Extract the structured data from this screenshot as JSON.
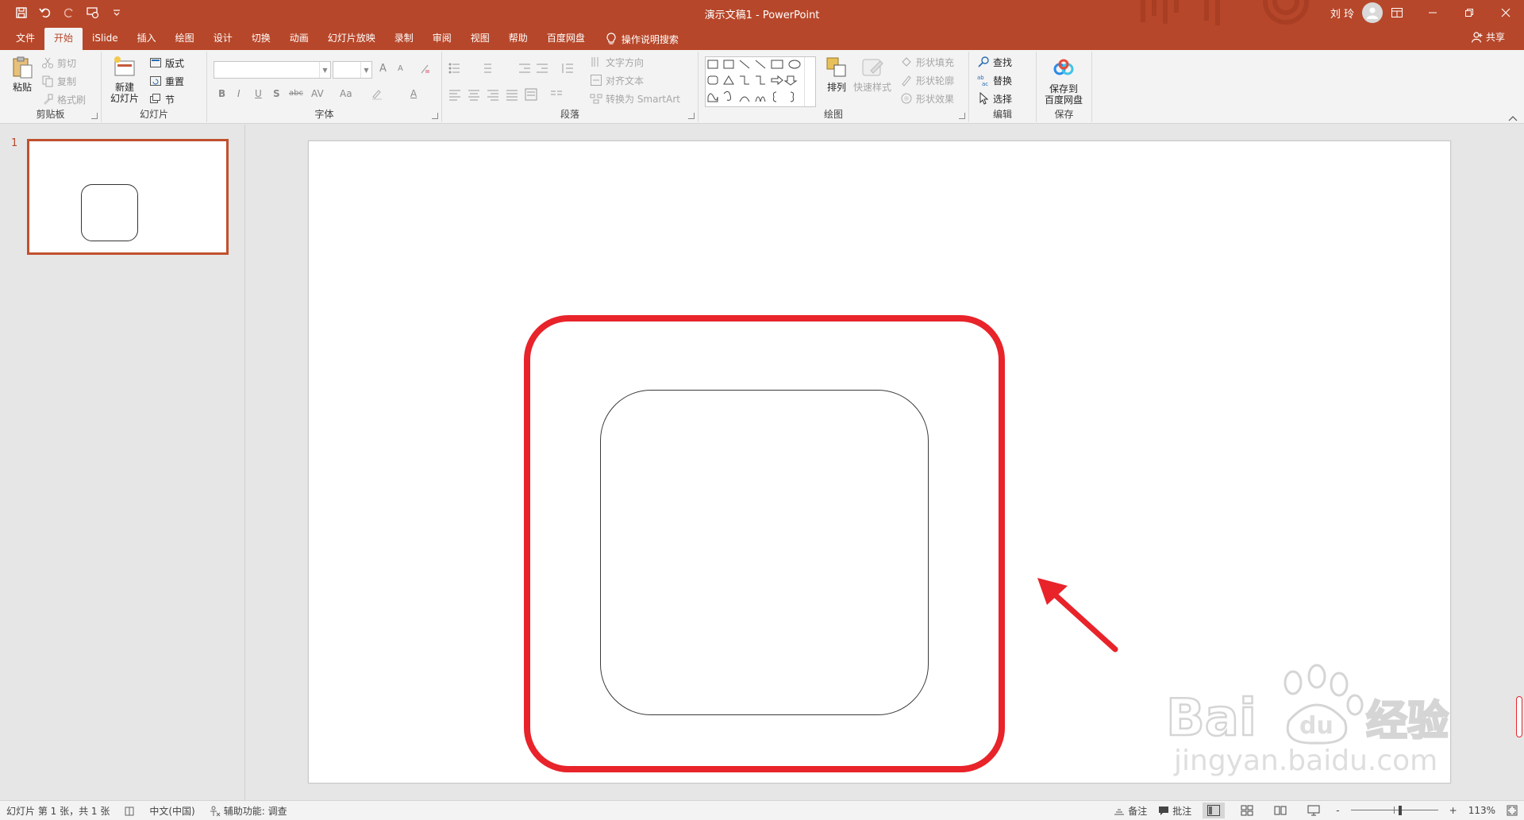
{
  "title_bar": {
    "document_title": "演示文稿1  -  PowerPoint",
    "user_name": "刘 玲",
    "colors": {
      "brand": "#b7472a",
      "ribbon": "#f3f3f3"
    }
  },
  "tabs": [
    {
      "label": "文件"
    },
    {
      "label": "开始",
      "active": true
    },
    {
      "label": "iSlide"
    },
    {
      "label": "插入"
    },
    {
      "label": "绘图"
    },
    {
      "label": "设计"
    },
    {
      "label": "切换"
    },
    {
      "label": "动画"
    },
    {
      "label": "幻灯片放映"
    },
    {
      "label": "录制"
    },
    {
      "label": "审阅"
    },
    {
      "label": "视图"
    },
    {
      "label": "帮助"
    },
    {
      "label": "百度网盘"
    }
  ],
  "tell_me": "操作说明搜索",
  "share": "共享",
  "ribbon": {
    "clipboard": {
      "label": "剪贴板",
      "paste": "粘贴",
      "cut": "剪切",
      "copy": "复制",
      "format_painter": "格式刷"
    },
    "slides": {
      "label": "幻灯片",
      "new_slide_line1": "新建",
      "new_slide_line2": "幻灯片",
      "layout": "版式",
      "reset": "重置",
      "section": "节"
    },
    "font": {
      "label": "字体",
      "bold": "B",
      "italic": "I",
      "underline": "U",
      "shadow": "S",
      "strike": "abc",
      "spacing": "AV",
      "case": "Aa",
      "grow": "A",
      "shrink": "A",
      "color": "A"
    },
    "paragraph": {
      "label": "段落",
      "text_direction": "文字方向",
      "align_text": "对齐文本",
      "smartart": "转换为 SmartArt"
    },
    "drawing": {
      "label": "绘图",
      "arrange": "排列",
      "quick_styles": "快速样式",
      "shape_fill": "形状填充",
      "shape_outline": "形状轮廓",
      "shape_effects": "形状效果"
    },
    "editing": {
      "label": "编辑",
      "find": "查找",
      "replace": "替换",
      "select": "选择"
    },
    "save": {
      "label": "保存",
      "save_to_line1": "保存到",
      "save_to_line2": "百度网盘"
    }
  },
  "thumbnails": [
    {
      "number": "1"
    }
  ],
  "status_bar": {
    "slide_info": "幻灯片 第 1 张，共 1 张",
    "language": "中文(中国)",
    "accessibility": "辅助功能: 调查",
    "notes": "备注",
    "comments": "批注",
    "zoom": "113%",
    "zoom_minus": "-",
    "zoom_plus": "+"
  },
  "annotation": {
    "highlight_color": "#e8232a"
  }
}
